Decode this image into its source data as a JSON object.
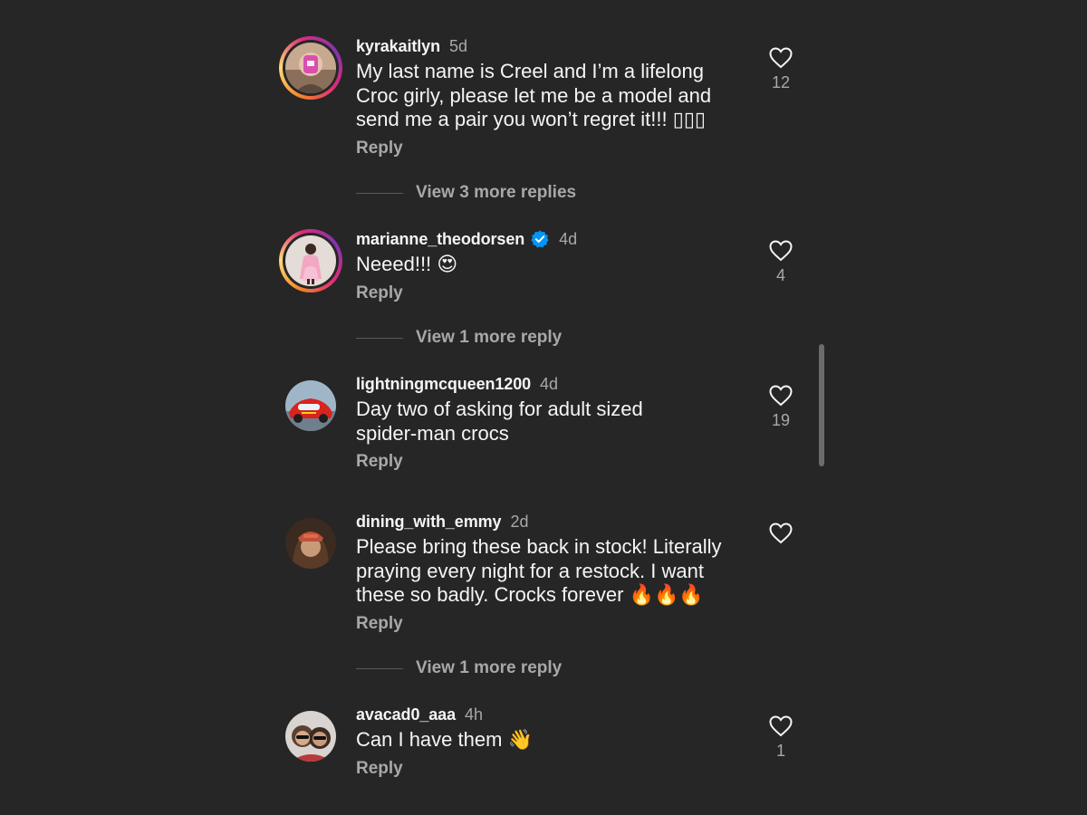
{
  "comments": [
    {
      "username": "kyrakaitlyn",
      "time": "5d",
      "text": "My last name is Creel and I’m a lifelong\nCroc girly, please let me be a model and\nsend me a pair you won’t regret it!!! ▯▯▯",
      "reply": "Reply",
      "likes": "12",
      "view_more": "View 3 more replies"
    },
    {
      "username": "marianne_theodorsen",
      "time": "4d",
      "text": "Neeed!!! 😍",
      "reply": "Reply",
      "likes": "4",
      "view_more": "View 1 more reply"
    },
    {
      "username": "lightningmcqueen1200",
      "time": "4d",
      "text": "Day two of asking for adult sized\nspider-man crocs",
      "reply": "Reply",
      "likes": "19"
    },
    {
      "username": "dining_with_emmy",
      "time": "2d",
      "text": "Please bring these back in stock! Literally\npraying every night for a restock. I want\nthese so badly. Crocks forever 🔥🔥🔥",
      "reply": "Reply",
      "likes": "",
      "view_more": "View 1 more reply"
    },
    {
      "username": "avacad0_aaa",
      "time": "4h",
      "text": "Can I have them 👋",
      "reply": "Reply",
      "likes": "1"
    }
  ],
  "colors": {
    "background": "#262626",
    "primary_text": "#f5f5f5",
    "secondary_text": "#a8a8a8",
    "verified_badge": "#0095f6"
  }
}
